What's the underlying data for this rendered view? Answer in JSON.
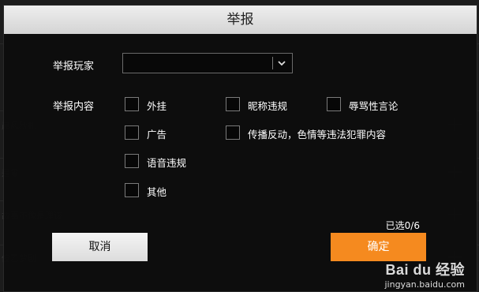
{
  "dialog": {
    "title": "举报",
    "player_label": "举报玩家",
    "player_select_value": "",
    "content_label": "举报内容",
    "options": [
      {
        "label": "外挂",
        "checked": false
      },
      {
        "label": "昵称违规",
        "checked": false
      },
      {
        "label": "辱骂性言论",
        "checked": false
      },
      {
        "label": "广告",
        "checked": false
      },
      {
        "label": "传播反动，色情等违法犯罪内容",
        "checked": false
      },
      {
        "label": "语音违规",
        "checked": false
      },
      {
        "label": "其他",
        "checked": false
      }
    ],
    "selected_count": "已选0/6",
    "cancel_label": "取消",
    "confirm_label": "确定"
  },
  "colors": {
    "confirm": "#f58a1f",
    "header_bg": "#e2e2e2",
    "modal_bg": "#0c0c0c"
  },
  "icons": [
    "chevron-down-icon"
  ],
  "watermark": {
    "logo": "Bai du 经验",
    "url": "jingyan.baidu.com"
  }
}
